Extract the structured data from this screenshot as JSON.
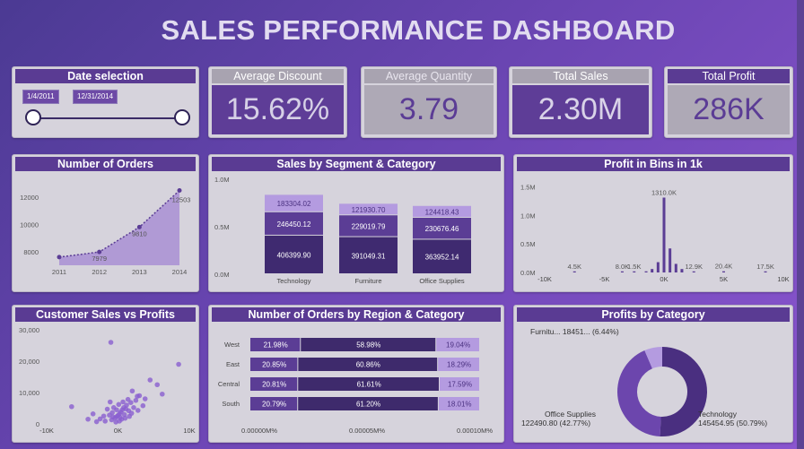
{
  "title": "SALES PERFORMANCE DASHBOARD",
  "date_selection": {
    "label": "Date selection",
    "start": "1/4/2011",
    "end": "12/31/2014"
  },
  "kpis": [
    {
      "label": "Average Discount",
      "value": "15.62%"
    },
    {
      "label": "Average Quantity",
      "value": "3.79"
    },
    {
      "label": "Total Sales",
      "value": "2.30M"
    },
    {
      "label": "Total Profit",
      "value": "286K"
    }
  ],
  "panels": {
    "orders": "Number of Orders",
    "segment": "Sales by Segment & Category",
    "bins": "Profit in Bins in 1k",
    "scatter": "Customer Sales vs Profits",
    "region": "Number of Orders by Region & Category",
    "profits_cat": "Profits by Category"
  },
  "chart_data": [
    {
      "type": "area",
      "title": "Number of Orders",
      "x": [
        "2011",
        "2012",
        "2013",
        "2014"
      ],
      "values": [
        7600,
        7979,
        9810,
        12503
      ],
      "data_labels": [
        "",
        "7979",
        "9810",
        "12503"
      ],
      "y_ticks": [
        "8000",
        "10000",
        "12000"
      ],
      "ylim": [
        7000,
        13000
      ]
    },
    {
      "type": "bar",
      "stacked": true,
      "title": "Sales by Segment & Category",
      "categories": [
        "Technology",
        "Furniture",
        "Office Supplies"
      ],
      "series": [
        {
          "values": [
            406399.9,
            391049.31,
            363952.14
          ],
          "labels": [
            "406399.90",
            "391049.31",
            "363952.14"
          ],
          "color": "#3f2a70"
        },
        {
          "values": [
            246450.12,
            229019.79,
            230676.46
          ],
          "labels": [
            "246450.12",
            "229019.79",
            "230676.46"
          ],
          "color": "#5b3d95"
        },
        {
          "values": [
            183304.02,
            121930.7,
            124418.43
          ],
          "labels": [
            "183304.02",
            "121930.70",
            "124418.43"
          ],
          "color": "#b49be0"
        }
      ],
      "y_ticks": [
        "0.0M",
        "0.5M",
        "1.0M"
      ],
      "ylim": [
        0,
        1000000
      ]
    },
    {
      "type": "bar",
      "title": "Profit in Bins in 1k",
      "x_ticks": [
        "-10K",
        "-5K",
        "0K",
        "5K",
        "10K"
      ],
      "y_ticks": [
        "0.0M",
        "0.5M",
        "1.0M",
        "1.5M"
      ],
      "xlim": [
        -10,
        10
      ],
      "ylim": [
        0,
        1600000
      ],
      "bins": [
        {
          "x": -7.5,
          "value": 4500,
          "label": "4.5K"
        },
        {
          "x": -3.5,
          "value": 8000,
          "label": "8.0K"
        },
        {
          "x": -2.5,
          "value": 1500,
          "label": "1.5K"
        },
        {
          "x": -1.5,
          "value": 20000
        },
        {
          "x": -1.0,
          "value": 60000
        },
        {
          "x": -0.5,
          "value": 180000
        },
        {
          "x": 0.0,
          "value": 1310000,
          "label": "1310.0K"
        },
        {
          "x": 0.5,
          "value": 420000
        },
        {
          "x": 1.0,
          "value": 150000
        },
        {
          "x": 1.5,
          "value": 60000
        },
        {
          "x": 2.5,
          "value": 12900,
          "label": "12.9K"
        },
        {
          "x": 5.0,
          "value": 20400,
          "label": "20.4K"
        },
        {
          "x": 8.5,
          "value": 17500,
          "label": "17.5K"
        }
      ]
    },
    {
      "type": "scatter",
      "title": "Customer Sales vs Profits",
      "x_ticks": [
        "-10K",
        "0K",
        "10K"
      ],
      "y_ticks": [
        "0",
        "10,000",
        "20,000",
        "30,000"
      ],
      "xlim": [
        -10000,
        10000
      ],
      "ylim": [
        0,
        30000
      ],
      "points": [
        [
          -1000,
          26000
        ],
        [
          -6500,
          5500
        ],
        [
          8500,
          19000
        ],
        [
          4500,
          14000
        ],
        [
          5500,
          12500
        ],
        [
          6200,
          9500
        ],
        [
          2000,
          10500
        ],
        [
          3000,
          9000
        ],
        [
          3800,
          8000
        ],
        [
          2500,
          7500
        ],
        [
          1800,
          6800
        ],
        [
          1200,
          6000
        ],
        [
          800,
          5200
        ],
        [
          600,
          4500
        ],
        [
          400,
          3800
        ],
        [
          200,
          3200
        ],
        [
          0,
          2700
        ],
        [
          -200,
          2300
        ],
        [
          -400,
          1900
        ],
        [
          300,
          2100
        ],
        [
          900,
          3000
        ],
        [
          1500,
          4200
        ],
        [
          2200,
          5200
        ],
        [
          -800,
          3600
        ],
        [
          -1500,
          4700
        ],
        [
          -1200,
          2800
        ],
        [
          -2000,
          2500
        ],
        [
          -2500,
          1600
        ],
        [
          -1800,
          900
        ],
        [
          -900,
          1300
        ],
        [
          -300,
          600
        ],
        [
          200,
          900
        ],
        [
          500,
          1500
        ],
        [
          1000,
          1800
        ],
        [
          1600,
          2400
        ],
        [
          2800,
          4300
        ],
        [
          3500,
          5800
        ],
        [
          -600,
          5200
        ],
        [
          100,
          6200
        ],
        [
          1400,
          7800
        ],
        [
          -3500,
          3200
        ],
        [
          -4200,
          1500
        ],
        [
          -3000,
          700
        ],
        [
          700,
          7000
        ],
        [
          2700,
          8800
        ],
        [
          -1100,
          7000
        ],
        [
          1100,
          4800
        ],
        [
          -200,
          4500
        ],
        [
          -700,
          2200
        ],
        [
          1900,
          3400
        ]
      ]
    },
    {
      "type": "bar",
      "orientation": "horizontal",
      "stacked_percent": true,
      "title": "Number of Orders by Region & Category",
      "categories": [
        "West",
        "East",
        "Central",
        "South"
      ],
      "series": [
        {
          "values": [
            21.98,
            20.85,
            20.81,
            20.79
          ],
          "labels": [
            "21.98%",
            "20.85%",
            "20.81%",
            "20.79%"
          ],
          "color": "#5b3d95"
        },
        {
          "values": [
            58.98,
            60.86,
            61.61,
            61.2
          ],
          "labels": [
            "58.98%",
            "60.86%",
            "61.61%",
            "61.20%"
          ],
          "color": "#3e2a6c"
        },
        {
          "values": [
            19.04,
            18.29,
            17.59,
            18.01
          ],
          "labels": [
            "19.04%",
            "18.29%",
            "17.59%",
            "18.01%"
          ],
          "color": "#b49be0"
        }
      ],
      "x_ticks": [
        "0.00000M%",
        "0.00005M%",
        "0.00010M%"
      ]
    },
    {
      "type": "pie",
      "donut": true,
      "title": "Profits by Category",
      "slices": [
        {
          "name": "Technology",
          "value": 145454.95,
          "pct": 50.79,
          "label": "Technology\n145454.95 (50.79%)",
          "color": "#4a2f80"
        },
        {
          "name": "Office Supplies",
          "value": 122490.8,
          "pct": 42.77,
          "label": "Office Supplies\n122490.80 (42.77%)",
          "color": "#6c46ad"
        },
        {
          "name": "Furniture",
          "value": 18451,
          "pct": 6.44,
          "label": "Furnitu... 18451... (6.44%)",
          "color": "#b49be0"
        }
      ]
    }
  ]
}
